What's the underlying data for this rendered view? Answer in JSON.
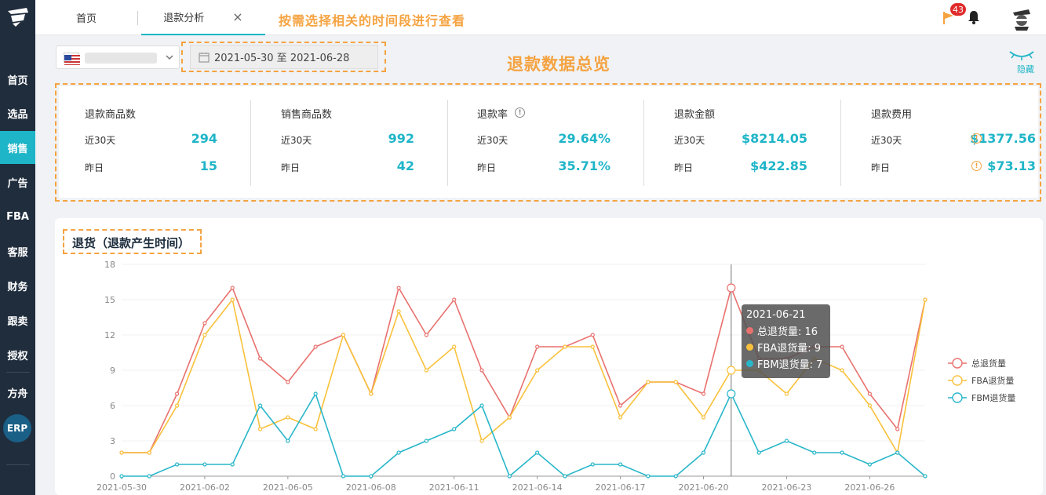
{
  "sidebar": {
    "items": [
      {
        "label": "首页",
        "active": false
      },
      {
        "label": "选品",
        "active": false
      },
      {
        "label": "销售",
        "active": true
      },
      {
        "label": "广告",
        "active": false
      },
      {
        "label": "FBA",
        "active": false
      },
      {
        "label": "客服",
        "active": false
      },
      {
        "label": "财务",
        "active": false
      },
      {
        "label": "跟卖",
        "active": false
      },
      {
        "label": "授权",
        "active": false
      },
      {
        "label": "方舟",
        "active": false
      }
    ],
    "erp_label": "ERP"
  },
  "tabs": [
    {
      "label": "首页"
    },
    {
      "label": "退款分析",
      "close": "×"
    }
  ],
  "header": {
    "hint": "按需选择相关的时间段进行查看",
    "notification_count": "43"
  },
  "filters": {
    "date_range": "2021-05-30 至 2021-06-28"
  },
  "overview": {
    "title": "退款数据总览",
    "hide_label": "隐藏"
  },
  "stats": [
    {
      "title": "退款商品数",
      "label30": "近30天",
      "val30": "294",
      "labelY": "昨日",
      "valY": "15"
    },
    {
      "title": "销售商品数",
      "label30": "近30天",
      "val30": "992",
      "labelY": "昨日",
      "valY": "42"
    },
    {
      "title": "退款率",
      "label30": "近30天",
      "val30": "29.64%",
      "labelY": "昨日",
      "valY": "35.71%"
    },
    {
      "title": "退款金额",
      "label30": "近30天",
      "val30": "$8214.05",
      "labelY": "昨日",
      "valY": "$422.85"
    },
    {
      "title": "退款费用",
      "label30": "近30天",
      "val30": "$1377.56",
      "labelY": "昨日",
      "valY": "$73.13"
    }
  ],
  "chart_section": {
    "title": "退货（退款产生时间）"
  },
  "tooltip": {
    "date": "2021-06-21",
    "rows": [
      "总退货量: 16",
      "FBA退货量: 9",
      "FBM退货量: 7"
    ]
  },
  "colors": {
    "accent": "#1fb5c8",
    "sidebar": "#1f2d3d",
    "highlight": "#f5a341"
  },
  "chart_data": {
    "type": "line",
    "x": [
      "2021-05-30",
      "2021-05-31",
      "2021-06-01",
      "2021-06-02",
      "2021-06-03",
      "2021-06-04",
      "2021-06-05",
      "2021-06-06",
      "2021-06-07",
      "2021-06-08",
      "2021-06-09",
      "2021-06-10",
      "2021-06-11",
      "2021-06-12",
      "2021-06-13",
      "2021-06-14",
      "2021-06-15",
      "2021-06-16",
      "2021-06-17",
      "2021-06-18",
      "2021-06-19",
      "2021-06-20",
      "2021-06-21",
      "2021-06-22",
      "2021-06-23",
      "2021-06-24",
      "2021-06-25",
      "2021-06-26",
      "2021-06-27",
      "2021-06-28"
    ],
    "xticks": [
      "2021-05-30",
      "2021-06-02",
      "2021-06-05",
      "2021-06-08",
      "2021-06-11",
      "2021-06-14",
      "2021-06-17",
      "2021-06-20",
      "2021-06-23",
      "2021-06-26"
    ],
    "yticks": [
      0,
      3,
      6,
      9,
      12,
      15,
      18
    ],
    "ylim": [
      0,
      18
    ],
    "series": [
      {
        "name": "总退货量",
        "color": "#e8716e",
        "values": [
          2,
          2,
          7,
          13,
          16,
          10,
          8,
          11,
          12,
          7,
          16,
          12,
          15,
          9,
          5,
          11,
          11,
          12,
          6,
          8,
          8,
          7,
          16,
          10,
          10,
          11,
          11,
          7,
          4,
          15
        ]
      },
      {
        "name": "FBA退货量",
        "color": "#f9c13b",
        "values": [
          2,
          2,
          6,
          12,
          15,
          4,
          5,
          4,
          12,
          7,
          14,
          9,
          11,
          3,
          5,
          9,
          11,
          11,
          5,
          8,
          8,
          5,
          9,
          9,
          7,
          10,
          9,
          6,
          2,
          15
        ]
      },
      {
        "name": "FBM退货量",
        "color": "#28b6c9",
        "values": [
          0,
          0,
          1,
          1,
          1,
          6,
          3,
          7,
          0,
          0,
          2,
          3,
          4,
          6,
          0,
          2,
          0,
          1,
          1,
          0,
          0,
          2,
          7,
          2,
          3,
          2,
          2,
          1,
          2,
          0
        ]
      }
    ],
    "hover_index": 22,
    "legend_position": "right"
  }
}
